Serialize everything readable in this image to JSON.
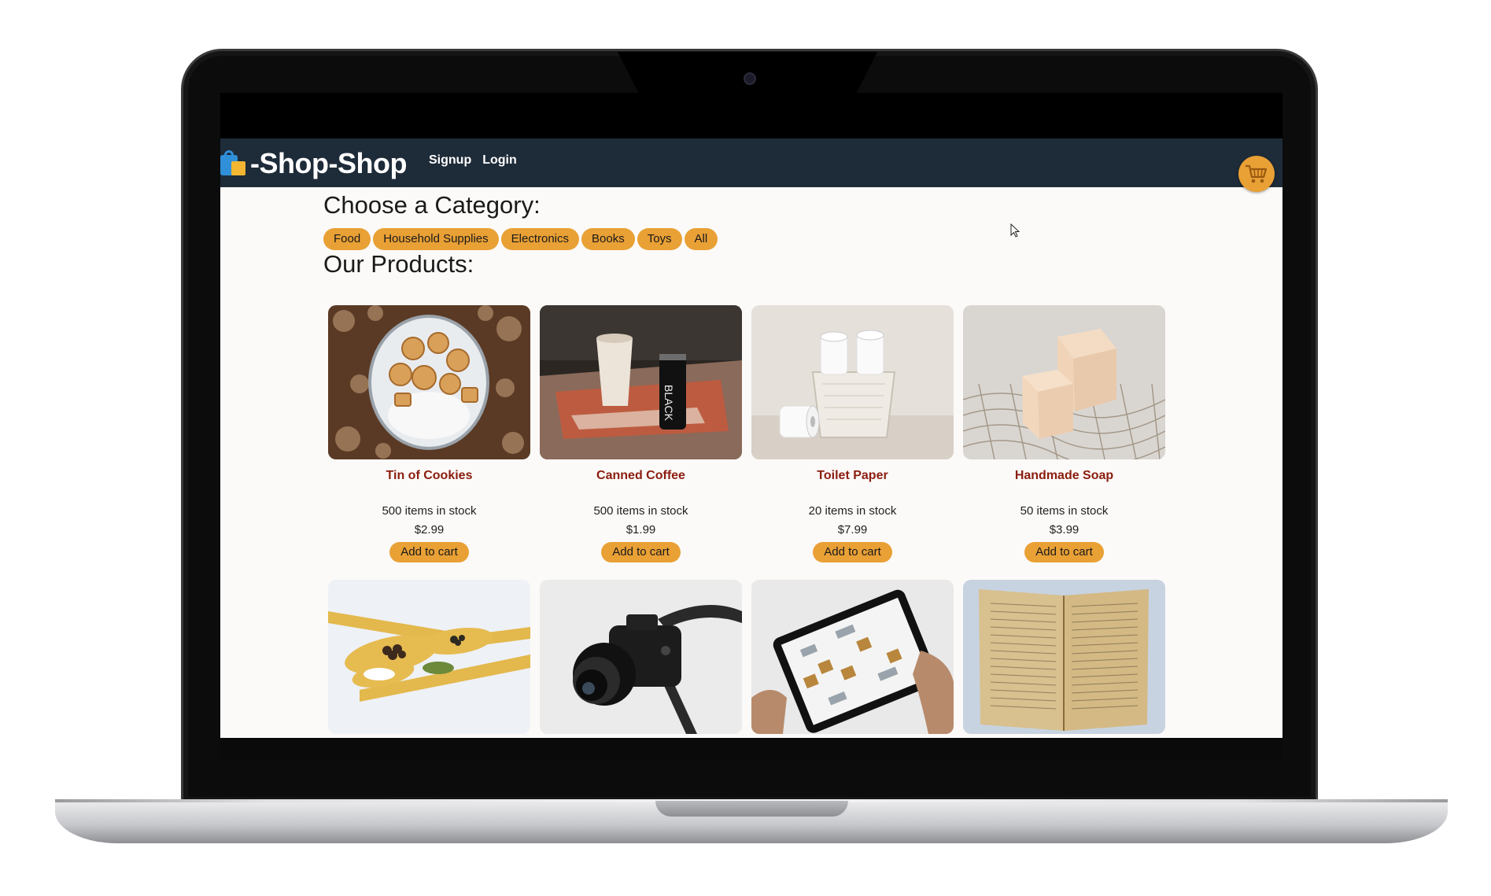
{
  "app": {
    "brand": "-Shop-Shop",
    "nav": [
      "Signup",
      "Login"
    ]
  },
  "categories": {
    "title": "Choose a Category:",
    "items": [
      "Food",
      "Household Supplies",
      "Electronics",
      "Books",
      "Toys",
      "All"
    ]
  },
  "products_section": {
    "title": "Our Products:",
    "add_label": "Add to cart",
    "items": [
      {
        "name": "Tin of Cookies",
        "stock": "500 items in stock",
        "price": "$2.99"
      },
      {
        "name": "Canned Coffee",
        "stock": "500 items in stock",
        "price": "$1.99"
      },
      {
        "name": "Toilet Paper",
        "stock": "20 items in stock",
        "price": "$7.99"
      },
      {
        "name": "Handmade Soap",
        "stock": "50 items in stock",
        "price": "$3.99"
      }
    ]
  },
  "icons": {
    "logo": "shopping-bag-icon",
    "cart": "cart-icon",
    "cursor": "mouse-cursor-icon"
  },
  "colors": {
    "navbar": "#1e2b39",
    "accent": "#e9a035",
    "product_title": "#8b1d0f",
    "page_bg": "#fbfaf8"
  }
}
